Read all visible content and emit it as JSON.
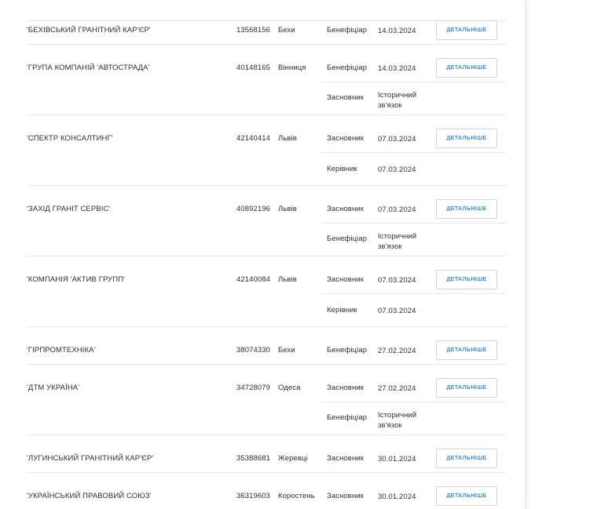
{
  "button_label": "ДЕТАЛЬНІШЕ",
  "companies": [
    {
      "name": "'БЕХІВСЬКИЙ ГРАНІТНИЙ КАР'ЄР'",
      "code": "13568156",
      "city": "Бехи",
      "links": [
        {
          "role": "Бенефіціар",
          "date": "14.03.2024"
        }
      ]
    },
    {
      "name": "'ГРУПА КОМПАНІЙ 'АВТОСТРАДА'",
      "code": "40148165",
      "city": "Вінниця",
      "links": [
        {
          "role": "Бенефіціар",
          "date": "14.03.2024"
        },
        {
          "role": "Засновник",
          "date": "Історичний зв'язок"
        }
      ]
    },
    {
      "name": "'СПЕКТР КОНСАЛТИНГ'",
      "code": "42140414",
      "city": "Львів",
      "links": [
        {
          "role": "Засновник",
          "date": "07.03.2024"
        },
        {
          "role": "Керівник",
          "date": "07.03.2024"
        }
      ]
    },
    {
      "name": "'ЗАХІД ГРАНІТ СЕРВІС'",
      "code": "40892196",
      "city": "Львів",
      "links": [
        {
          "role": "Засновник",
          "date": "07.03.2024"
        },
        {
          "role": "Бенефіціар",
          "date": "Історичний зв'язок"
        }
      ]
    },
    {
      "name": "'КОМПАНІЯ 'АКТИВ ГРУПП'",
      "code": "42140084",
      "city": "Львів",
      "links": [
        {
          "role": "Засновник",
          "date": "07.03.2024"
        },
        {
          "role": "Керівник",
          "date": "07.03.2024"
        }
      ]
    },
    {
      "name": "'ГІРПРОМТЕХНІКА'",
      "code": "38074330",
      "city": "Бехи",
      "links": [
        {
          "role": "Бенефіціар",
          "date": "27.02.2024"
        }
      ]
    },
    {
      "name": "'ДТМ УКРАЇНА'",
      "code": "34728079",
      "city": "Одеса",
      "links": [
        {
          "role": "Засновник",
          "date": "27.02.2024"
        },
        {
          "role": "Бенефіціар",
          "date": "Історичний зв'язок"
        }
      ]
    },
    {
      "name": "'ЛУГИНСЬКИЙ ГРАНІТНИЙ КАР'ЄР'",
      "code": "35388681",
      "city": "Жеревці",
      "links": [
        {
          "role": "Засновник",
          "date": "30.01.2024"
        }
      ]
    },
    {
      "name": "'УКРАЇНСЬКИЙ ПРАВОВИЙ СОЮЗ'",
      "code": "36319603",
      "city": "Коростень",
      "links": [
        {
          "role": "Засновник",
          "date": "30.01.2024"
        }
      ]
    }
  ]
}
